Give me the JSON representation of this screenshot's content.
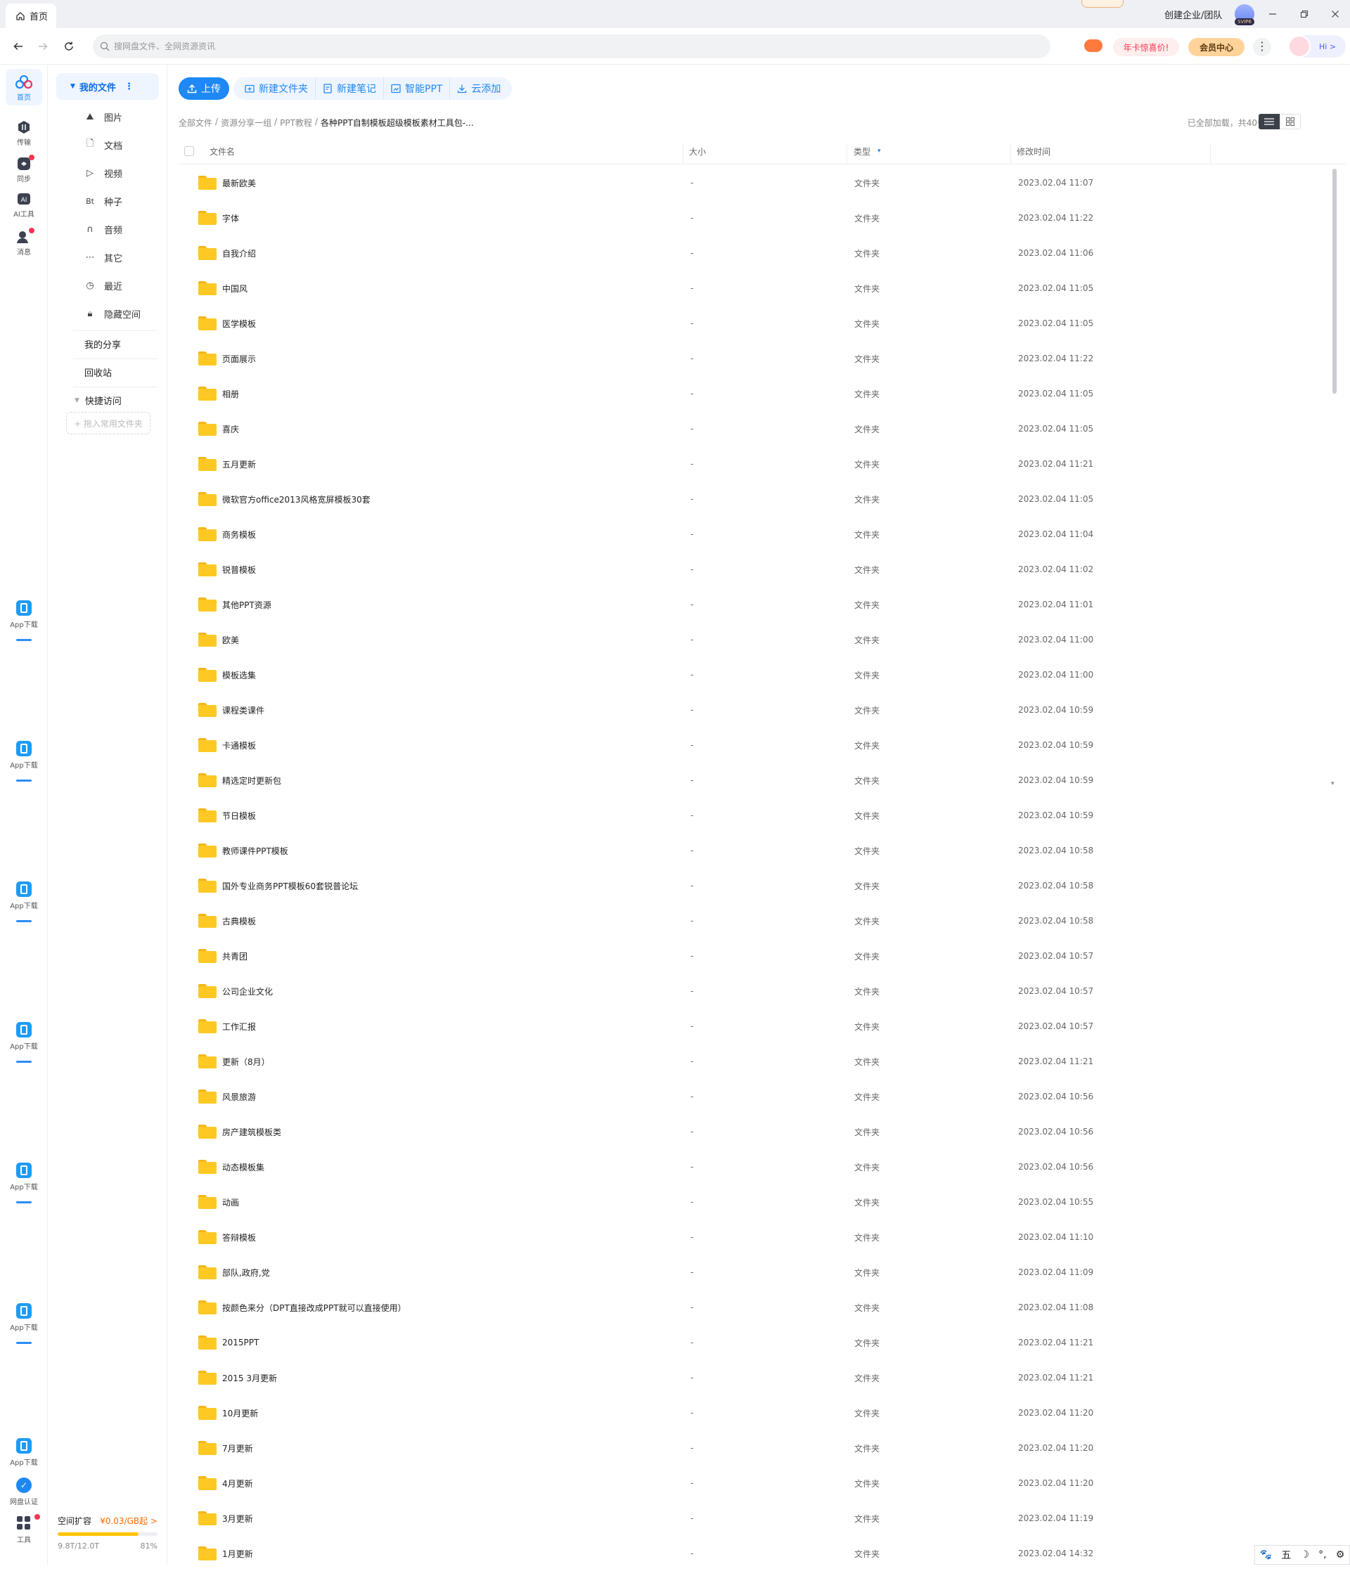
{
  "titlebar": {
    "tab_label": "首页",
    "enterprise_label": "创建企业/团队",
    "vip_badge": "SVIP6"
  },
  "addressbar": {
    "search_placeholder": "搜网盘文件、全网资源资讯",
    "promo_label": "年卡惊喜价!",
    "member_label": "会员中心",
    "hi_label": "Hi >"
  },
  "rail": {
    "items": [
      {
        "label": "首页",
        "icon": "home-cloud-icon"
      },
      {
        "label": "传输",
        "icon": "transfer-icon"
      },
      {
        "label": "同步",
        "icon": "sync-icon"
      },
      {
        "label": "AI工具",
        "icon": "ai-tool-icon"
      },
      {
        "label": "消息",
        "icon": "message-icon"
      }
    ],
    "app_download_label": "App下载",
    "verify_label": "网盘认证",
    "tools_label": "工具"
  },
  "sidebar": {
    "my_files": "我的文件",
    "categories": [
      {
        "label": "图片",
        "icon": "image-icon"
      },
      {
        "label": "文档",
        "icon": "document-icon"
      },
      {
        "label": "视频",
        "icon": "video-icon"
      },
      {
        "label": "种子",
        "icon": "torrent-icon"
      },
      {
        "label": "音频",
        "icon": "audio-icon"
      },
      {
        "label": "其它",
        "icon": "more-icon"
      },
      {
        "label": "最近",
        "icon": "clock-icon"
      },
      {
        "label": "隐藏空间",
        "icon": "lock-icon"
      }
    ],
    "my_share": "我的分享",
    "recycle": "回收站",
    "quick_access": "快捷访问",
    "add_fav": "+ 拖入常用文件夹",
    "storage": {
      "title": "空间扩容",
      "price": "¥0.03/GB起 >",
      "used": "9.8T/12.0T",
      "percent_text": "81%",
      "percent": 81
    }
  },
  "toolbar": {
    "upload": "上传",
    "tools": [
      {
        "label": "新建文件夹",
        "icon": "new-folder-icon"
      },
      {
        "label": "新建笔记",
        "icon": "new-note-icon"
      },
      {
        "label": "智能PPT",
        "icon": "smart-ppt-icon"
      },
      {
        "label": "云添加",
        "icon": "cloud-add-icon"
      }
    ]
  },
  "breadcrumb": [
    "全部文件",
    "资源分享一组",
    "PPT教程",
    "各种PPT自制模板超级模板素材工具包-..."
  ],
  "summary": "已全部加载，共40个",
  "table": {
    "headers": {
      "name": "文件名",
      "size": "大小",
      "type": "类型",
      "modified": "修改时间"
    },
    "rows": [
      {
        "name": "最新欧美",
        "size": "-",
        "type": "文件夹",
        "modified": "2023.02.04 11:07"
      },
      {
        "name": "字体",
        "size": "-",
        "type": "文件夹",
        "modified": "2023.02.04 11:22"
      },
      {
        "name": "自我介绍",
        "size": "-",
        "type": "文件夹",
        "modified": "2023.02.04 11:06"
      },
      {
        "name": "中国风",
        "size": "-",
        "type": "文件夹",
        "modified": "2023.02.04 11:05"
      },
      {
        "name": "医学模板",
        "size": "-",
        "type": "文件夹",
        "modified": "2023.02.04 11:05"
      },
      {
        "name": "页面展示",
        "size": "-",
        "type": "文件夹",
        "modified": "2023.02.04 11:22"
      },
      {
        "name": "相册",
        "size": "-",
        "type": "文件夹",
        "modified": "2023.02.04 11:05"
      },
      {
        "name": "喜庆",
        "size": "-",
        "type": "文件夹",
        "modified": "2023.02.04 11:05"
      },
      {
        "name": "五月更新",
        "size": "-",
        "type": "文件夹",
        "modified": "2023.02.04 11:21"
      },
      {
        "name": "微软官方office2013风格宽屏模板30套",
        "size": "-",
        "type": "文件夹",
        "modified": "2023.02.04 11:05"
      },
      {
        "name": "商务模板",
        "size": "-",
        "type": "文件夹",
        "modified": "2023.02.04 11:04"
      },
      {
        "name": "锐普模板",
        "size": "-",
        "type": "文件夹",
        "modified": "2023.02.04 11:02"
      },
      {
        "name": "其他PPT资源",
        "size": "-",
        "type": "文件夹",
        "modified": "2023.02.04 11:01"
      },
      {
        "name": "欧美",
        "size": "-",
        "type": "文件夹",
        "modified": "2023.02.04 11:00"
      },
      {
        "name": "模板选集",
        "size": "-",
        "type": "文件夹",
        "modified": "2023.02.04 11:00"
      },
      {
        "name": "课程类课件",
        "size": "-",
        "type": "文件夹",
        "modified": "2023.02.04 10:59"
      },
      {
        "name": "卡通模板",
        "size": "-",
        "type": "文件夹",
        "modified": "2023.02.04 10:59"
      },
      {
        "name": "精选定时更新包",
        "size": "-",
        "type": "文件夹",
        "modified": "2023.02.04 10:59"
      },
      {
        "name": "节日模板",
        "size": "-",
        "type": "文件夹",
        "modified": "2023.02.04 10:59"
      },
      {
        "name": "教师课件PPT模板",
        "size": "-",
        "type": "文件夹",
        "modified": "2023.02.04 10:58"
      },
      {
        "name": "国外专业商务PPT模板60套锐普论坛",
        "size": "-",
        "type": "文件夹",
        "modified": "2023.02.04 10:58"
      },
      {
        "name": "古典模板",
        "size": "-",
        "type": "文件夹",
        "modified": "2023.02.04 10:58"
      },
      {
        "name": "共青团",
        "size": "-",
        "type": "文件夹",
        "modified": "2023.02.04 10:57"
      },
      {
        "name": "公司企业文化",
        "size": "-",
        "type": "文件夹",
        "modified": "2023.02.04 10:57"
      },
      {
        "name": "工作汇报",
        "size": "-",
        "type": "文件夹",
        "modified": "2023.02.04 10:57"
      },
      {
        "name": "更新（8月）",
        "size": "-",
        "type": "文件夹",
        "modified": "2023.02.04 11:21"
      },
      {
        "name": "风景旅游",
        "size": "-",
        "type": "文件夹",
        "modified": "2023.02.04 10:56"
      },
      {
        "name": "房产建筑模板类",
        "size": "-",
        "type": "文件夹",
        "modified": "2023.02.04 10:56"
      },
      {
        "name": "动态模板集",
        "size": "-",
        "type": "文件夹",
        "modified": "2023.02.04 10:56"
      },
      {
        "name": "动画",
        "size": "-",
        "type": "文件夹",
        "modified": "2023.02.04 10:55"
      },
      {
        "name": "答辩模板",
        "size": "-",
        "type": "文件夹",
        "modified": "2023.02.04 11:10"
      },
      {
        "name": "部队,政府,党",
        "size": "-",
        "type": "文件夹",
        "modified": "2023.02.04 11:09"
      },
      {
        "name": "按颜色来分（DPT直接改成PPT就可以直接使用）",
        "size": "-",
        "type": "文件夹",
        "modified": "2023.02.04 11:08"
      },
      {
        "name": "2015PPT",
        "size": "-",
        "type": "文件夹",
        "modified": "2023.02.04 11:21"
      },
      {
        "name": "2015 3月更新",
        "size": "-",
        "type": "文件夹",
        "modified": "2023.02.04 11:21"
      },
      {
        "name": "10月更新",
        "size": "-",
        "type": "文件夹",
        "modified": "2023.02.04 11:20"
      },
      {
        "name": "7月更新",
        "size": "-",
        "type": "文件夹",
        "modified": "2023.02.04 11:20"
      },
      {
        "name": "4月更新",
        "size": "-",
        "type": "文件夹",
        "modified": "2023.02.04 11:20"
      },
      {
        "name": "3月更新",
        "size": "-",
        "type": "文件夹",
        "modified": "2023.02.04 11:19"
      },
      {
        "name": "1月更新",
        "size": "-",
        "type": "文件夹",
        "modified": "2023.02.04 14:32"
      }
    ]
  },
  "ime": {
    "items": [
      "🐾",
      "五",
      "☽",
      "°,",
      "⚙"
    ]
  },
  "colors": {
    "accent": "#1e88f5",
    "folder": "#ffc823",
    "badge": "#f5374f"
  }
}
